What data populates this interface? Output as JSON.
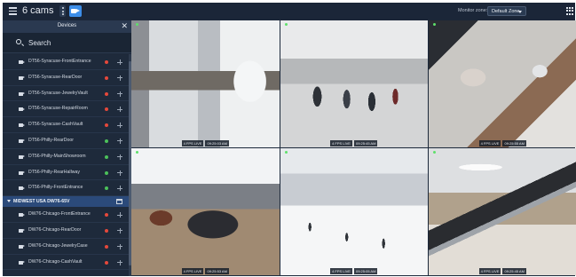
{
  "header": {
    "title": "6 cams",
    "monitor_zone_label": "Monitor zone:",
    "zone_select_value": "Default Zone"
  },
  "sidebar": {
    "title": "Devices",
    "search_placeholder": "Search",
    "rows": [
      {
        "type": "device",
        "name": "DT56-Syracuse-FrontEntrance",
        "status_color": "#e5483b"
      },
      {
        "type": "device",
        "name": "DT56-Syracuse-RearDoor",
        "status_color": "#e5483b"
      },
      {
        "type": "device",
        "name": "DT56-Syracuse-JewelryVault",
        "status_color": "#e5483b"
      },
      {
        "type": "device",
        "name": "DT56-Syracuse-RepairRoom",
        "status_color": "#e5483b"
      },
      {
        "type": "device",
        "name": "DT56-Syracuse-CashVault",
        "status_color": "#e5483b"
      },
      {
        "type": "device",
        "name": "DT56-Philly-RearDoor",
        "status_color": "#4cc15a"
      },
      {
        "type": "device",
        "name": "DT56-Philly-MainShowroom",
        "status_color": "#4cc15a"
      },
      {
        "type": "device",
        "name": "DT56-Philly-RearHallway",
        "status_color": "#4cc15a"
      },
      {
        "type": "device",
        "name": "DT56-Philly-FrontEntrance",
        "status_color": "#4cc15a"
      },
      {
        "type": "group",
        "name": "MIDWEST USA DW76-65V"
      },
      {
        "type": "device",
        "name": "DW76-Chicago-FrontEntrance",
        "status_color": "#e5483b"
      },
      {
        "type": "device",
        "name": "DW76-Chicago-RearDoor",
        "status_color": "#e5483b"
      },
      {
        "type": "device",
        "name": "DW76-Chicago-JewelryCase",
        "status_color": "#e5483b"
      },
      {
        "type": "device",
        "name": "DW76-Chicago-CashVault",
        "status_color": "#e5483b"
      }
    ]
  },
  "tiles": [
    {
      "scene": "retail-store-interior",
      "fps": "4 FPS LIVE",
      "time": "09:25:03 AM"
    },
    {
      "scene": "shoppers-walking-corridor",
      "fps": "4 FPS LIVE",
      "time": "09:25:45 AM"
    },
    {
      "scene": "overhead-store-view",
      "fps": "4 FPS LIVE",
      "time": "09:25:55 AM"
    },
    {
      "scene": "clothing-racks",
      "fps": "4 FPS LIVE",
      "time": "09:25:53 AM"
    },
    {
      "scene": "bright-atrium",
      "fps": "4 FPS LIVE",
      "time": "09:25:05 AM"
    },
    {
      "scene": "mall-escalator",
      "fps": "4 FPS LIVE",
      "time": "09:25:45 AM"
    }
  ],
  "colors": {
    "accent": "#3d8ee8",
    "live": "#5ee06a",
    "offline": "#e5483b",
    "online": "#4cc15a",
    "group_bg": "#2b4a7a"
  }
}
